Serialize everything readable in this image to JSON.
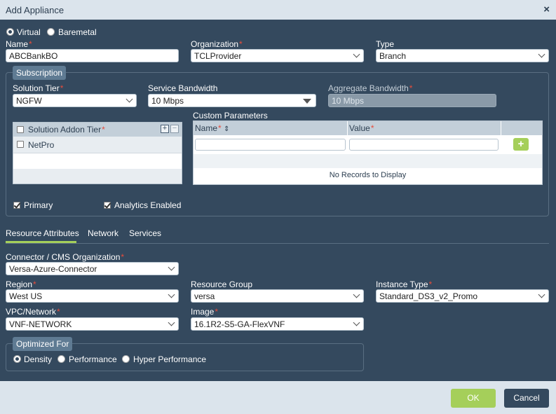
{
  "dialog": {
    "title": "Add Appliance",
    "close_label": "×"
  },
  "deployment": {
    "options": [
      "Virtual",
      "Baremetal"
    ],
    "selected": "Virtual"
  },
  "fields": {
    "name": {
      "label": "Name",
      "value": "ABCBankBO"
    },
    "organization": {
      "label": "Organization",
      "value": "TCLProvider"
    },
    "type": {
      "label": "Type",
      "value": "Branch"
    }
  },
  "subscription": {
    "legend": "Subscription",
    "solution_tier": {
      "label": "Solution Tier",
      "value": "NGFW"
    },
    "service_bandwidth": {
      "label": "Service Bandwidth",
      "value": "10 Mbps"
    },
    "aggregate_bandwidth": {
      "label": "Aggregate Bandwidth",
      "value": "10 Mbps"
    },
    "addon_table": {
      "header": "Solution Addon Tier",
      "add_icon": "+",
      "remove_icon": "−",
      "rows": [
        "NetPro"
      ]
    },
    "custom_params": {
      "title": "Custom Parameters",
      "col_name": "Name",
      "col_value": "Value",
      "sort_icon": "⇕",
      "add_icon": "+",
      "empty_text": "No Records to Display"
    },
    "primary": {
      "label": "Primary",
      "checked": true
    },
    "analytics": {
      "label": "Analytics Enabled",
      "checked": true
    }
  },
  "tabs": {
    "items": [
      "Resource Attributes",
      "Network",
      "Services"
    ],
    "active": "Resource Attributes"
  },
  "resource": {
    "connector": {
      "label": "Connector / CMS Organization",
      "value": "Versa-Azure-Connector"
    },
    "region": {
      "label": "Region",
      "value": "West US"
    },
    "resource_group": {
      "label": "Resource Group",
      "value": "versa"
    },
    "instance_type": {
      "label": "Instance Type",
      "value": "Standard_DS3_v2_Promo"
    },
    "vpc": {
      "label": "VPC/Network",
      "value": "VNF-NETWORK"
    },
    "image": {
      "label": "Image",
      "value": "16.1R2-S5-GA-FlexVNF"
    }
  },
  "optimized": {
    "legend": "Optimized For",
    "options": [
      "Density",
      "Performance",
      "Hyper Performance"
    ],
    "selected": "Density"
  },
  "buttons": {
    "ok": "OK",
    "cancel": "Cancel"
  },
  "colors": {
    "accent": "#a5cf5a",
    "panel": "#34495e",
    "header": "#dbe4ec",
    "required": "#e74c3c"
  }
}
